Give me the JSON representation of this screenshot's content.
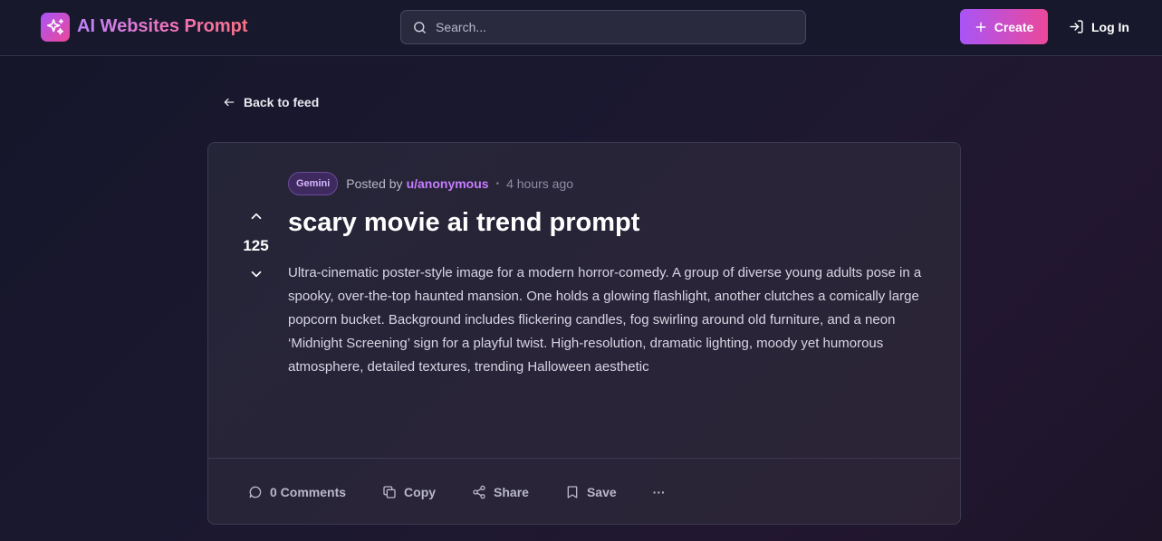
{
  "header": {
    "app_name": "AI Websites Prompt",
    "search_placeholder": "Search...",
    "create_label": "Create",
    "login_label": "Log In"
  },
  "nav": {
    "back_label": "Back to feed"
  },
  "post": {
    "votes": "125",
    "tag": "Gemini",
    "posted_by_label": "Posted by",
    "author": "u/anonymous",
    "separator": "•",
    "time_ago": "4 hours ago",
    "title": "scary movie ai trend prompt",
    "body": "Ultra-cinematic poster-style image for a modern horror-comedy. A group of diverse young adults pose in a spooky, over-the-top haunted mansion. One holds a glowing flashlight, another clutches a comically large popcorn bucket. Background includes flickering candles, fog swirling around old furniture, and a neon ‘Midnight Screening’ sign for a playful twist. High-resolution, dramatic lighting, moody yet humorous atmosphere, detailed textures, trending Halloween aesthetic"
  },
  "actions": {
    "comments_label": "0 Comments",
    "copy_label": "Copy",
    "share_label": "Share",
    "save_label": "Save",
    "more_label": "···"
  },
  "colors": {
    "accent_start": "#a855f7",
    "accent_end": "#ec4899",
    "author": "#c77dff"
  },
  "icons": [
    "sparkles-icon",
    "search-icon",
    "plus-icon",
    "login-icon",
    "arrow-left-icon",
    "chevron-up-icon",
    "chevron-down-icon",
    "comment-icon",
    "copy-icon",
    "share-icon",
    "bookmark-icon",
    "more-icon"
  ]
}
